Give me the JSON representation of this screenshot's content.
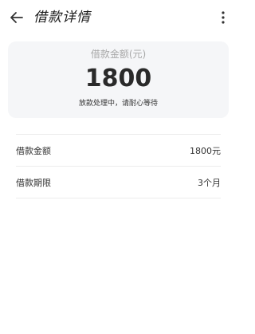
{
  "header": {
    "title": "借款详情",
    "back_icon": "arrow-left-icon",
    "more_icon": "more-vertical-icon"
  },
  "summary": {
    "label": "借款金额(元)",
    "amount": "1800",
    "status": "放款处理中，请耐心等待"
  },
  "details": [
    {
      "label": "借款金额",
      "value": "1800元"
    },
    {
      "label": "借款期限",
      "value": "3个月"
    }
  ]
}
